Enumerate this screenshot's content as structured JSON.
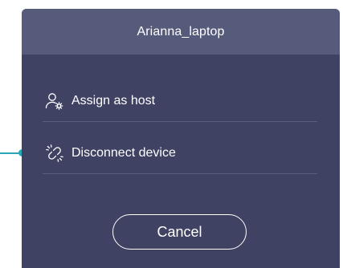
{
  "dialog": {
    "title": "Arianna_laptop",
    "items": [
      {
        "label": "Assign as host",
        "icon": "user-gear-icon"
      },
      {
        "label": "Disconnect device",
        "icon": "broken-link-icon"
      }
    ],
    "cancel_label": "Cancel"
  },
  "colors": {
    "dialog_bg": "#3f4262",
    "header_bg": "#565a7b",
    "divider": "#5a5e80",
    "accent": "#2aa6b8",
    "text": "#ffffff"
  }
}
